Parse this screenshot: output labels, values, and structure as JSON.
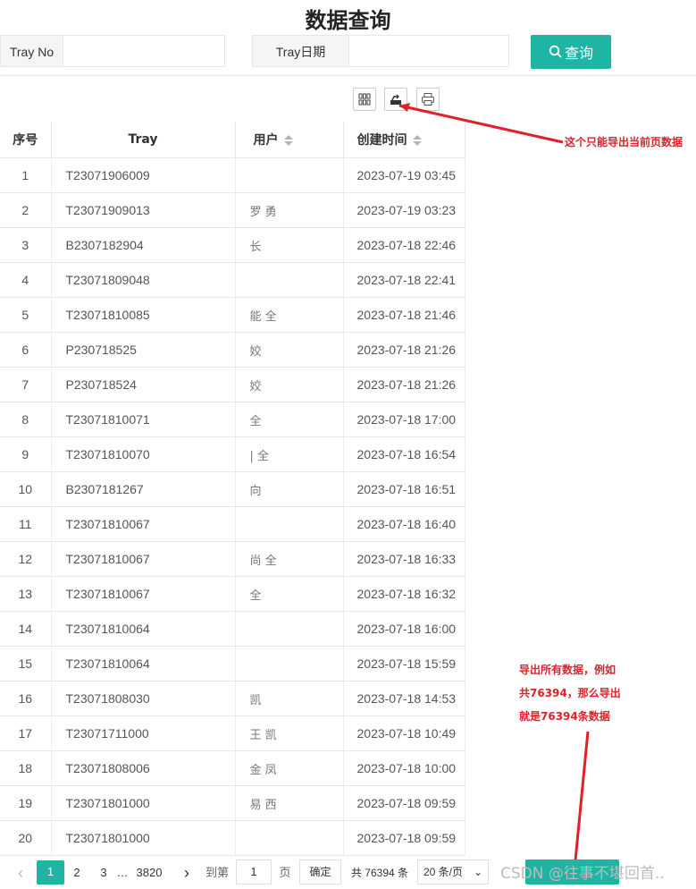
{
  "page": {
    "title": "数据查询"
  },
  "search": {
    "tray_no_label": "Tray No",
    "tray_no_value": "",
    "tray_date_label": "Tray日期",
    "tray_date_value": "",
    "query_button": "查询"
  },
  "toolbar": {
    "columns_icon": "grid-icon",
    "export_icon": "export-icon",
    "print_icon": "print-icon"
  },
  "table": {
    "headers": [
      "序号",
      "Tray",
      "用户",
      "创建时间"
    ],
    "rows": [
      {
        "no": "1",
        "tray": "T23071906009",
        "user": "",
        "time": "2023-07-19 03:45"
      },
      {
        "no": "2",
        "tray": "T23071909013",
        "user": "罗  勇",
        "time": "2023-07-19 03:23"
      },
      {
        "no": "3",
        "tray": "B2307182904",
        "user": "     长",
        "time": "2023-07-18 22:46"
      },
      {
        "no": "4",
        "tray": "T23071809048",
        "user": "",
        "time": "2023-07-18 22:41"
      },
      {
        "no": "5",
        "tray": "T23071810085",
        "user": "  能  全",
        "time": "2023-07-18 21:46"
      },
      {
        "no": "6",
        "tray": "P230718525",
        "user": "   姣",
        "time": "2023-07-18 21:26"
      },
      {
        "no": "7",
        "tray": "P230718524",
        "user": "   姣",
        "time": "2023-07-18 21:26"
      },
      {
        "no": "8",
        "tray": "T23071810071",
        "user": "    全",
        "time": "2023-07-18 17:00"
      },
      {
        "no": "9",
        "tray": "T23071810070",
        "user": "|   全",
        "time": "2023-07-18 16:54"
      },
      {
        "no": "10",
        "tray": "B2307181267",
        "user": "向  ",
        "time": "2023-07-18 16:51"
      },
      {
        "no": "11",
        "tray": "T23071810067",
        "user": "   ",
        "time": "2023-07-18 16:40"
      },
      {
        "no": "12",
        "tray": "T23071810067",
        "user": "尚  全",
        "time": "2023-07-18 16:33"
      },
      {
        "no": "13",
        "tray": "T23071810067",
        "user": "   全",
        "time": "2023-07-18 16:32"
      },
      {
        "no": "14",
        "tray": "T23071810064",
        "user": "   ",
        "time": "2023-07-18 16:00"
      },
      {
        "no": "15",
        "tray": "T23071810064",
        "user": "   ",
        "time": "2023-07-18 15:59"
      },
      {
        "no": "16",
        "tray": "T23071808030",
        "user": "   凯",
        "time": "2023-07-18 14:53"
      },
      {
        "no": "17",
        "tray": "T23071711000",
        "user": "王  凯",
        "time": "2023-07-18 10:49"
      },
      {
        "no": "18",
        "tray": "T23071808006",
        "user": "   金  凤",
        "time": "2023-07-18 10:00"
      },
      {
        "no": "19",
        "tray": "T23071801000",
        "user": "易  西",
        "time": "2023-07-18 09:59"
      },
      {
        "no": "20",
        "tray": "T23071801000",
        "user": "   ",
        "time": "2023-07-18 09:59"
      }
    ]
  },
  "annotations": {
    "export_current": "这个只能导出当前页数据",
    "export_all_1": "导出所有数据，例如",
    "export_all_2": "共76394，那么导出",
    "export_all_3": "就是76394条数据"
  },
  "pager": {
    "prev": "‹",
    "pages": [
      "1",
      "2",
      "3",
      "…",
      "3820"
    ],
    "next": "›",
    "goto_label": "到第",
    "goto_value": "1",
    "page_unit": "页",
    "confirm": "确定",
    "total": "共 76394 条",
    "page_size": "20 条/页"
  },
  "watermark": "CSDN @往事不堪回首..",
  "colors": {
    "accent": "#1fb5a5",
    "annotation": "#e0202a"
  }
}
